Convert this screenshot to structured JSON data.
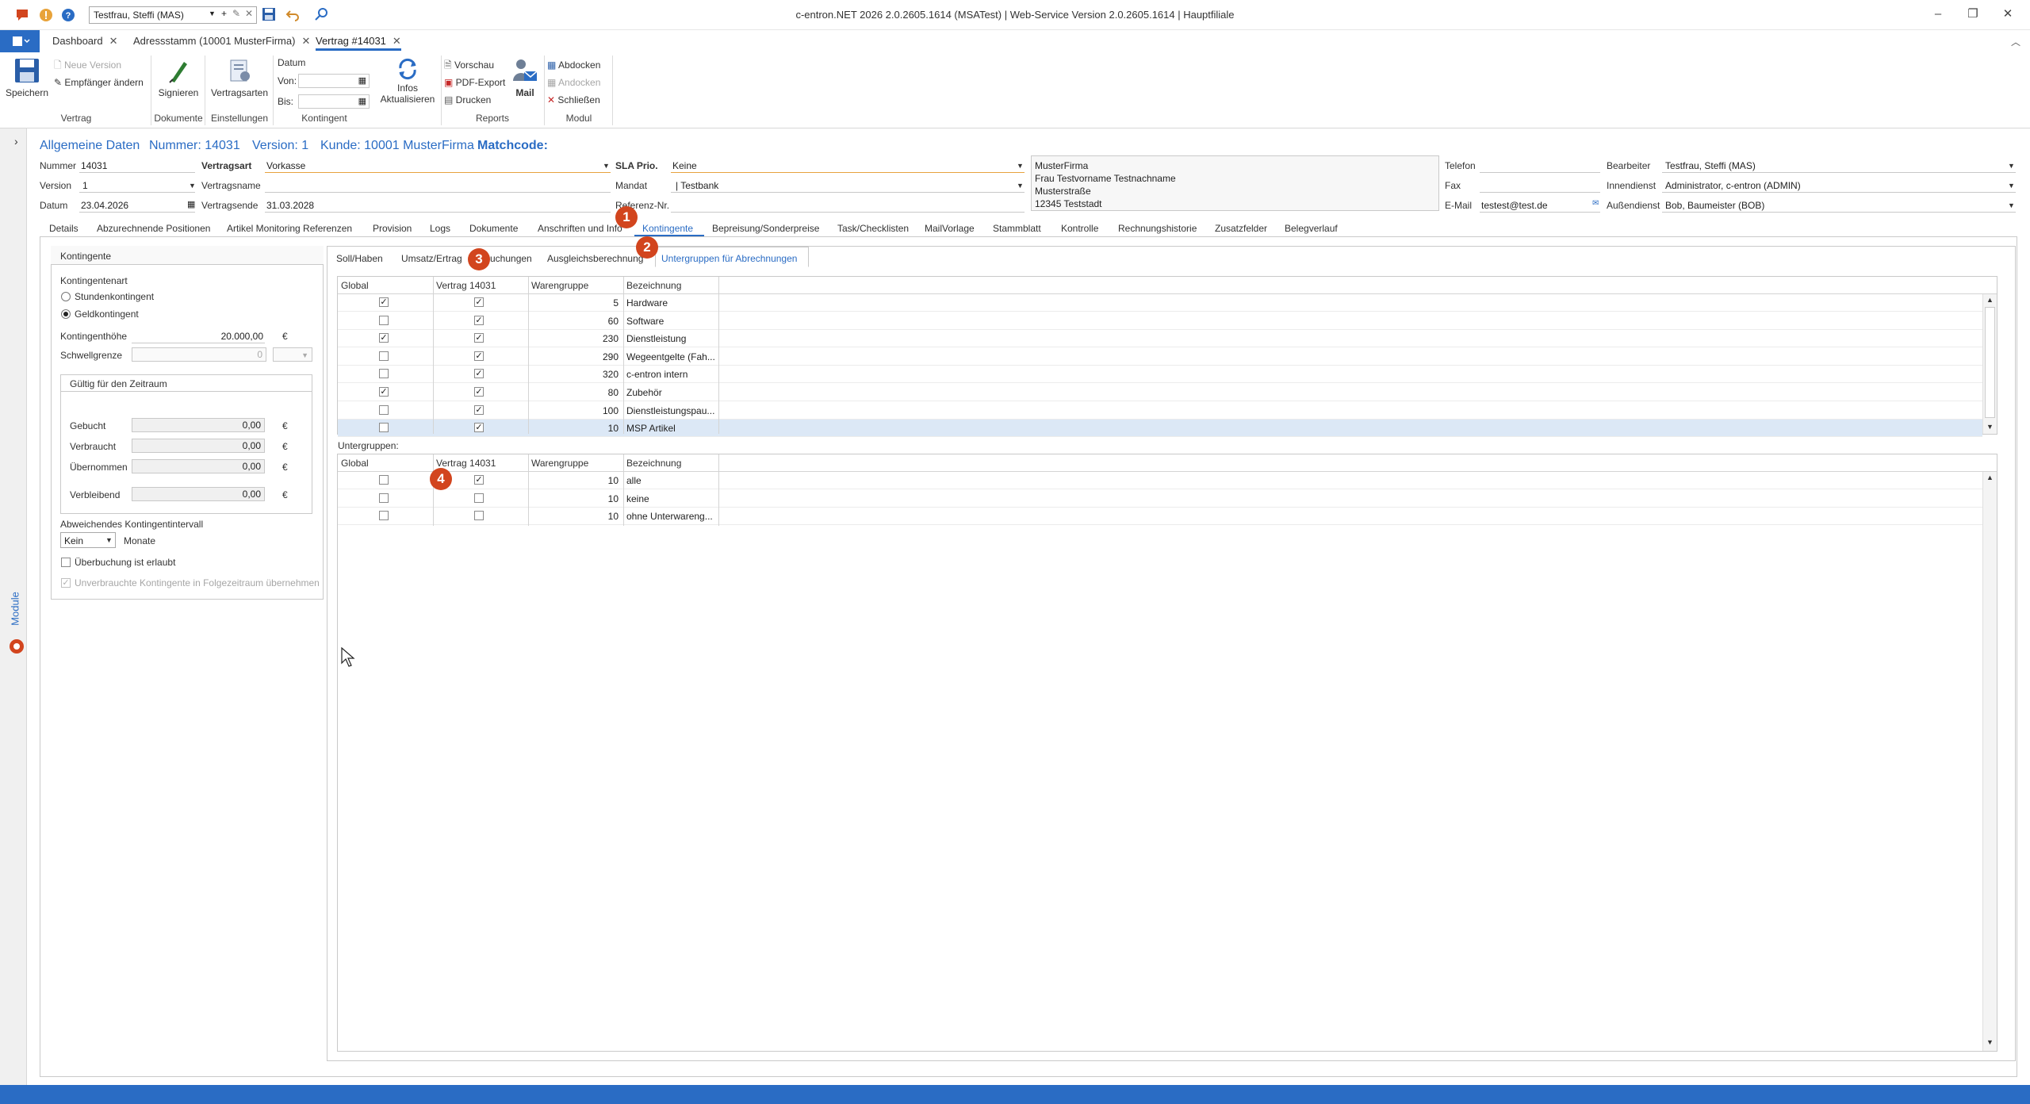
{
  "window": {
    "title": "c-entron.NET 2026 2.0.2605.1614 (MSATest) | Web-Service Version 2.0.2605.1614 | Hauptfiliale",
    "user_combo": "Testfrau, Steffi (MAS)"
  },
  "doc_tabs": [
    {
      "label": "Dashboard"
    },
    {
      "label": "Adressstamm (10001 MusterFirma)"
    },
    {
      "label": "Vertrag #14031"
    }
  ],
  "ribbon": {
    "save": "Speichern",
    "new_version": "Neue Version",
    "change_recipient": "Empfänger ändern",
    "group_vertrag": "Vertrag",
    "sign": "Signieren",
    "group_dokumente": "Dokumente",
    "contract_types": "Vertragsarten",
    "group_einstellungen": "Einstellungen",
    "datum": "Datum",
    "von": "Von:",
    "bis": "Bis:",
    "infos_1": "Infos",
    "infos_2": "Aktualisieren",
    "group_kontingent": "Kontingent",
    "preview": "Vorschau",
    "pdf_export": "PDF-Export",
    "print": "Drucken",
    "mail": "Mail",
    "group_reports": "Reports",
    "dock": "Abdocken",
    "undock": "Andocken",
    "close": "Schließen",
    "group_modul": "Modul"
  },
  "side": {
    "module_label": "Module"
  },
  "header": {
    "section": "Allgemeine Daten",
    "nummer": "Nummer: 14031",
    "version": "Version: 1",
    "kunde": "Kunde: 10001 MusterFirma",
    "matchcode": "Matchcode:"
  },
  "form": {
    "nummer_label": "Nummer",
    "nummer_value": "14031",
    "version_label": "Version",
    "version_value": "1",
    "datum_label": "Datum",
    "datum_value": "23.04.2026",
    "vertragsart_label": "Vertragsart",
    "vertragsart_value": "Vorkasse",
    "vertragsname_label": "Vertragsname",
    "vertragsname_value": "",
    "vertragsende_label": "Vertragsende",
    "vertragsende_value": "31.03.2028",
    "sla_label": "SLA Prio.",
    "sla_value": "Keine",
    "mandat_label": "Mandat",
    "mandat_value": "| Testbank",
    "referenz_label": "Referenz-Nr.",
    "address_1": "MusterFirma",
    "address_2": "Frau Testvorname Testnachname",
    "address_3": "Musterstraße",
    "address_4": "12345 Teststadt",
    "telefon_label": "Telefon",
    "fax_label": "Fax",
    "email_label": "E-Mail",
    "email_value": "testest@test.de",
    "bearbeiter_label": "Bearbeiter",
    "bearbeiter_value": "Testfrau, Steffi (MAS)",
    "innendienst_label": "Innendienst",
    "innendienst_value": "Administrator, c-entron (ADMIN)",
    "aussendienst_label": "Außendienst",
    "aussendienst_value": "Bob, Baumeister (BOB)"
  },
  "main_tabs": [
    "Details",
    "Abzurechnende Positionen",
    "Artikel Monitoring Referenzen",
    "Provision",
    "Logs",
    "Dokumente",
    "Anschriften und Info",
    "Kontingente",
    "Bepreisung/Sonderpreise",
    "Task/Checklisten",
    "MailVorlage",
    "Stammblatt",
    "Kontrolle",
    "Rechnungshistorie",
    "Zusatzfelder",
    "Belegverlauf"
  ],
  "kontingente_panel": {
    "title": "Kontingente",
    "art_label": "Kontingentenart",
    "opt_stunden": "Stundenkontingent",
    "opt_geld": "Geldkontingent",
    "hoehe_label": "Kontingenthöhe",
    "hoehe_value": "20.000,00",
    "currency": "€",
    "schwelle_label": "Schwellgrenze",
    "schwelle_value": "0",
    "zeitraum_title": "Gültig für den Zeitraum",
    "gebucht_label": "Gebucht",
    "gebucht_value": "0,00",
    "verbraucht_label": "Verbraucht",
    "verbraucht_value": "0,00",
    "uebernommen_label": "Übernommen",
    "uebernommen_value": "0,00",
    "verbleibend_label": "Verbleibend",
    "verbleibend_value": "0,00",
    "intervall_label": "Abweichendes Kontingentintervall",
    "intervall_value": "Kein",
    "monate": "Monate",
    "ueberbuchung": "Überbuchung ist erlaubt",
    "uebernehmen": "Unverbrauchte Kontingente in Folgezeitraum übernehmen"
  },
  "sub_tabs": [
    "Soll/Haben",
    "Umsatz/Ertrag",
    "Buchungen",
    "Ausgleichsberechnung",
    "Untergruppen für Abrechnungen"
  ],
  "grid_columns": [
    "Global",
    "Vertrag 14031",
    "Warengruppe",
    "Bezeichnung"
  ],
  "grid1_rows": [
    {
      "global": true,
      "vertrag": true,
      "wg": "5",
      "bez": "Hardware"
    },
    {
      "global": false,
      "vertrag": true,
      "wg": "60",
      "bez": "Software"
    },
    {
      "global": true,
      "vertrag": true,
      "wg": "230",
      "bez": "Dienstleistung"
    },
    {
      "global": false,
      "vertrag": true,
      "wg": "290",
      "bez": "Wegeentgelte (Fah..."
    },
    {
      "global": false,
      "vertrag": true,
      "wg": "320",
      "bez": "c-entron intern"
    },
    {
      "global": true,
      "vertrag": true,
      "wg": "80",
      "bez": "Zubehör"
    },
    {
      "global": false,
      "vertrag": true,
      "wg": "100",
      "bez": "Dienstleistungspau..."
    },
    {
      "global": false,
      "vertrag": true,
      "wg": "10",
      "bez": "MSP Artikel"
    }
  ],
  "untergruppen_label": "Untergruppen:",
  "grid2_rows": [
    {
      "global": false,
      "vertrag": true,
      "wg": "10",
      "bez": "alle"
    },
    {
      "global": false,
      "vertrag": false,
      "wg": "10",
      "bez": "keine"
    },
    {
      "global": false,
      "vertrag": false,
      "wg": "10",
      "bez": "ohne Unterwareng..."
    }
  ],
  "callouts": [
    "1",
    "2",
    "3",
    "4"
  ],
  "colors": {
    "accent": "#2a6cc4",
    "callout": "#d2451e",
    "required_line": "#e7a33e"
  }
}
